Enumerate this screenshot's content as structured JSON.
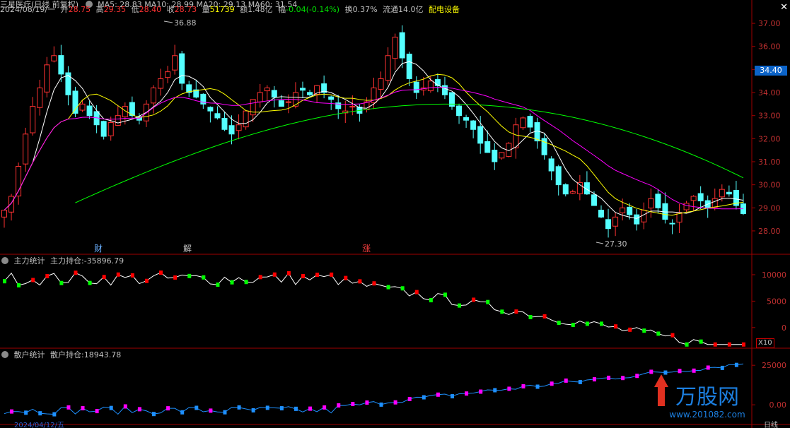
{
  "header": {
    "stock_name": "三星医疗(日线 前复权)",
    "ma_text": "MA5: 28.83  MA10: 28.99  MA20: 29.13  MA60: 31.54",
    "date": "2024/08/19/一",
    "open_label": "开",
    "open": "28.75",
    "high_label": "高",
    "high": "29.35",
    "low_label": "低",
    "low": "28.40",
    "close_label": "收",
    "close": "28.73",
    "volume_label": "量",
    "volume": "51739",
    "amount_label": "额",
    "amount": "1.48亿",
    "change_label": "幅",
    "change": "-0.04(-0.14%)",
    "turnover_label": "换",
    "turnover": "0.37%",
    "float_label": "流通",
    "float": "14.0亿",
    "sector": "配电设备"
  },
  "close_icon": "close-icon",
  "current_price_tag": "34.40",
  "price_axis_labels": [
    "37.00",
    "36.00",
    "35.00",
    "34.00",
    "33.00",
    "32.00",
    "31.00",
    "30.00",
    "29.00",
    "28.00"
  ],
  "annotations": {
    "high_marker": "36.88",
    "low_marker": "27.30"
  },
  "event_markers": [
    "财",
    "解",
    "涨"
  ],
  "panel1": {
    "title": "主力统计",
    "value_label": "主力持仓:",
    "value": "-35896.79",
    "axis_labels": [
      "10000",
      "5000",
      "0"
    ],
    "scale_badge": "X10"
  },
  "panel2": {
    "title": "散户统计",
    "value_label": "散户持仓:",
    "value": "18943.78",
    "axis_labels": [
      "25000",
      "0.00"
    ]
  },
  "watermark": {
    "brand": "万股网",
    "url": "www.201082.com"
  },
  "footer": {
    "date_label": "2024/04/12/五",
    "period": "日线"
  },
  "colors": {
    "up": "#ff3232",
    "down": "#54ffff",
    "ma5": "#ffffff",
    "ma10": "#ffff00",
    "ma20": "#ff00ff",
    "ma60": "#00ff00",
    "pos": "#ff0000",
    "neg": "#00ff00",
    "retail_up": "#ff00ff",
    "retail_down": "#1e90ff"
  }
}
